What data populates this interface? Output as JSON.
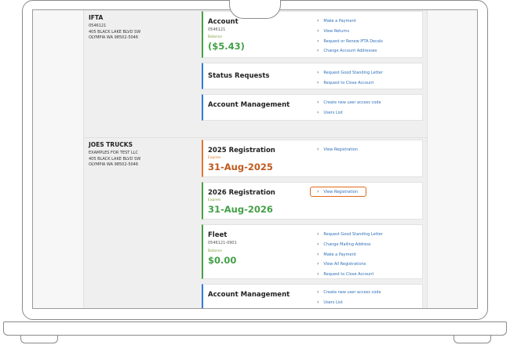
{
  "ifta": {
    "name": "IFTA",
    "account_no": "0546121",
    "address1": "405 BLACK LAKE BLVD SW",
    "address2": "OLYMPIA WA 98502-5046",
    "account": {
      "title": "Account",
      "sub": "0546121",
      "balance_label": "Balance",
      "balance": "($5.43)",
      "links": [
        "Make a Payment",
        "View Returns",
        "Request or Renew IFTA Decals",
        "Change Account Addresses"
      ]
    },
    "status": {
      "title": "Status Requests",
      "links": [
        "Request Good Standing Letter",
        "Request to Close Account"
      ]
    },
    "management": {
      "title": "Account Management",
      "links": [
        "Create new user access code",
        "Users List"
      ]
    }
  },
  "joes": {
    "name": "JOES TRUCKS",
    "line1": "EXAMPLES FOR TEST LLC",
    "address1": "405 BLACK LAKE BLVD SW",
    "address2": "OLYMPIA WA 98502-5046",
    "reg2025": {
      "title": "2025 Registration",
      "expires_label": "Expires",
      "date": "31-Aug-2025",
      "links": [
        "View Registration"
      ]
    },
    "reg2026": {
      "title": "2026 Registration",
      "expires_label": "Expires",
      "date": "31-Aug-2026",
      "links": [
        "View Registration"
      ]
    },
    "fleet": {
      "title": "Fleet",
      "sub": "0546121-0901",
      "balance_label": "Balance",
      "balance": "$0.00",
      "links": [
        "Request Good Standing Letter",
        "Change Mailing Address",
        "Make a Payment",
        "View All Registrations",
        "Request to Close Account"
      ]
    },
    "management": {
      "title": "Account Management",
      "links": [
        "Create new user access code",
        "Users List"
      ]
    }
  }
}
